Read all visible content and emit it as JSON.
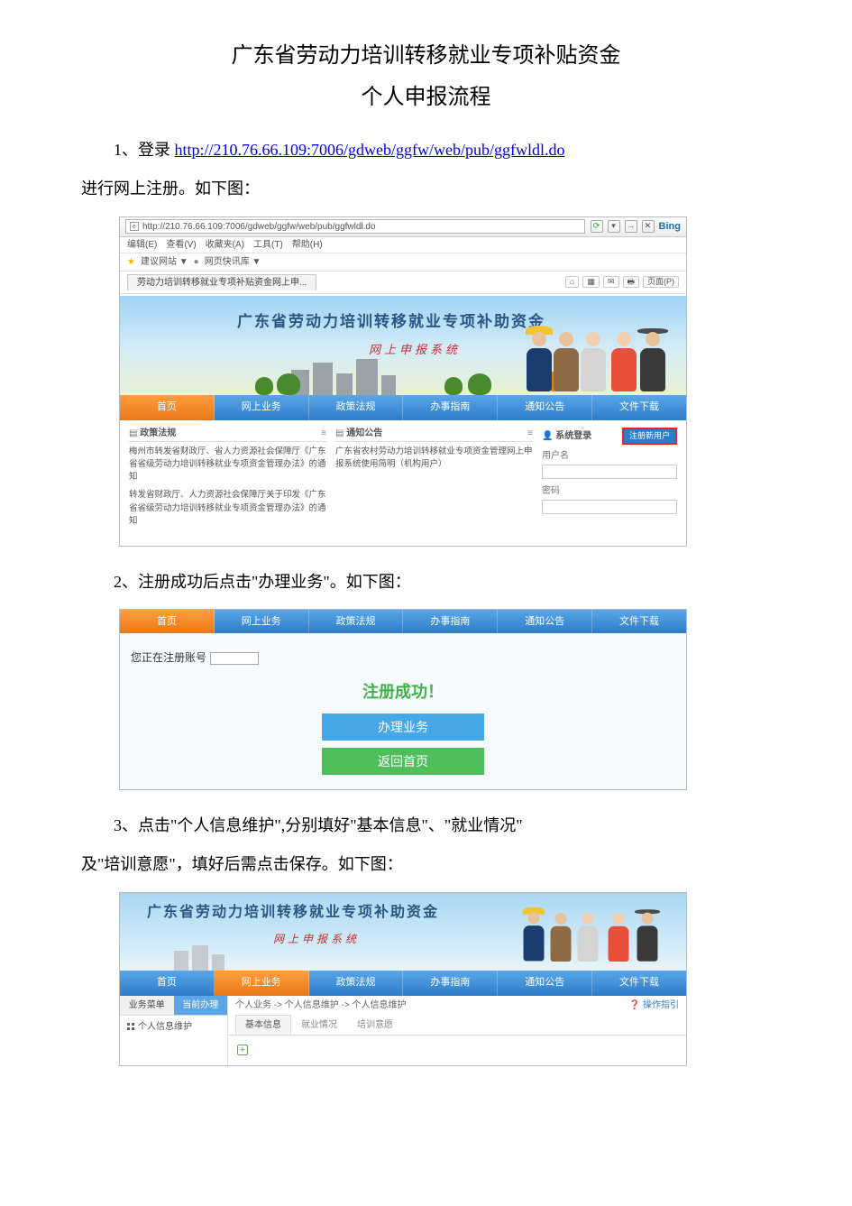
{
  "doc": {
    "title_line1": "广东省劳动力培训转移就业专项补贴资金",
    "title_line2": "个人申报流程",
    "step1_prefix": "1、登录 ",
    "step1_url": "http://210.76.66.109:7006/gdweb/ggfw/web/pub/ggfwldl.do",
    "step1_suffix": "进行网上注册。如下图：",
    "step2": "2、注册成功后点击\"办理业务\"。如下图：",
    "step3_a": "3、点击\"个人信息维护\",分别填好\"基本信息\"、\"就业情况\"",
    "step3_b": "及\"培训意愿\"，填好后需点击保存。如下图："
  },
  "shot1": {
    "url": "http://210.76.66.109:7006/gdweb/ggfw/web/pub/ggfwldl.do",
    "bing": "Bing",
    "menus": [
      "编辑(E)",
      "查看(V)",
      "收藏夹(A)",
      "工具(T)",
      "帮助(H)"
    ],
    "fav_site": "建议网站 ▼",
    "fav_more": "网页快讯库 ▼",
    "tab_title": "劳动力培训转移就业专项补贴资金网上申...",
    "page_tool": "页面(P)",
    "banner_title": "广东省劳动力培训转移就业专项补助资金",
    "banner_sub": "网上申报系统",
    "nav": [
      "首页",
      "网上业务",
      "政策法规",
      "办事指南",
      "通知公告",
      "文件下载"
    ],
    "col_law": "政策法规",
    "col_notice": "通知公告",
    "news1": "梅州市转发省财政厅、省人力资源社会保障厅《广东省省级劳动力培训转移就业专项资金管理办法》的通知",
    "news2": "转发省财政厅、人力资源社会保障厅关于印发《广东省省级劳动力培训转移就业专项资金管理办法》的通知",
    "news3": "广东省农村劳动力培训转移就业专项资金管理网上申报系统使用简明（机构用户）",
    "login_title": "系统登录",
    "register_btn": "注册新用户",
    "user_label": "用户名",
    "pass_label": "密码"
  },
  "shot2": {
    "nav": [
      "首页",
      "网上业务",
      "政策法规",
      "办事指南",
      "通知公告",
      "文件下载"
    ],
    "reg_label": "您正在注册账号",
    "success": "注册成功！",
    "btn_biz": "办理业务",
    "btn_home": "返回首页"
  },
  "shot3": {
    "banner_title": "广东省劳动力培训转移就业专项补助资金",
    "banner_sub": "网上申报系统",
    "nav": [
      "首页",
      "网上业务",
      "政策法规",
      "办事指南",
      "通知公告",
      "文件下载"
    ],
    "side_tab1": "业务菜单",
    "side_tab2": "当前办理",
    "side_item": "个人信息维护",
    "crumb": "个人业务 -> 个人信息维护 -> 个人信息维护",
    "help": "操作指引",
    "subtabs": [
      "基本信息",
      "就业情况",
      "培训意愿"
    ]
  }
}
